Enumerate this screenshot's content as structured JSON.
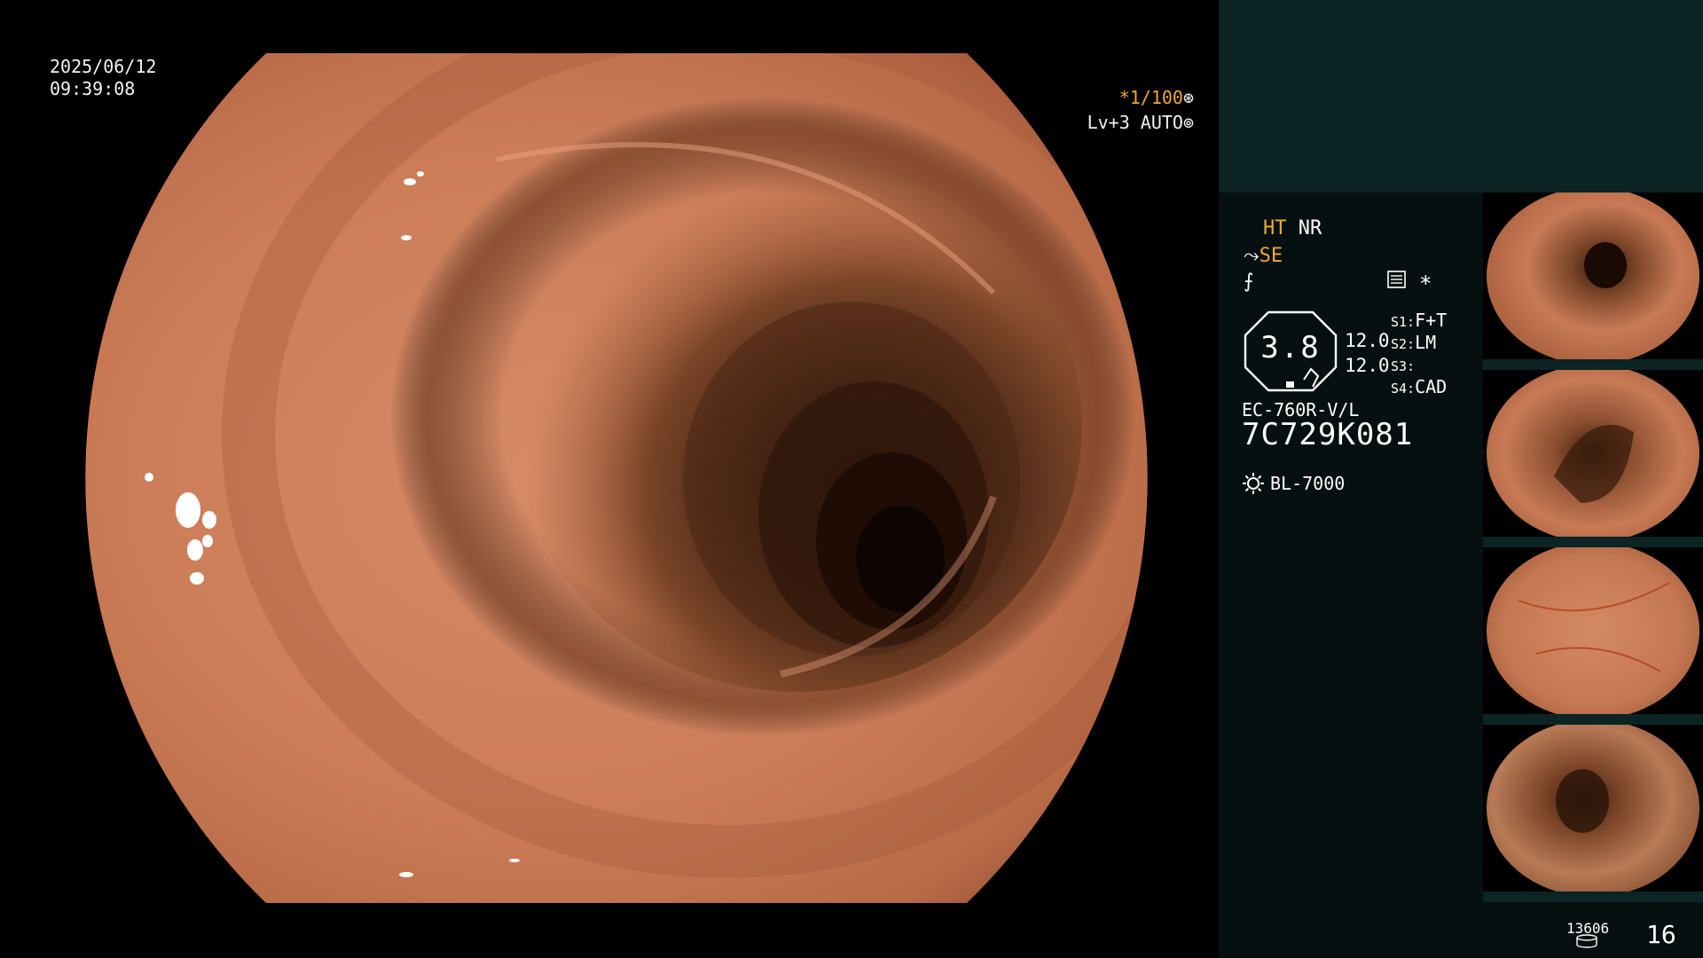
{
  "overlay": {
    "date": "2025/06/12",
    "time": "09:39:08",
    "shutter": "*1/100",
    "shutter_icon": "aperture-icon",
    "level": "Lv+3 AUTO",
    "level_icon": "iris-icon"
  },
  "panel": {
    "ht": "HT",
    "nr": "NR",
    "se": "SE",
    "se_icon": "structure-enhance-icon",
    "freeze_icon": "freeze-icon",
    "menu_icon": "menu-icon",
    "star": "*",
    "gauge_value": "3.8",
    "value_a": "12.0",
    "value_b": "12.0",
    "switches": [
      {
        "key": "S1:",
        "value": "F+T"
      },
      {
        "key": "S2:",
        "value": "LM"
      },
      {
        "key": "S3:",
        "value": ""
      },
      {
        "key": "S4:",
        "value": "CAD"
      }
    ],
    "scope_model": "EC-760R-V/L",
    "scope_serial": "7C729K081",
    "light_source": "BL-7000",
    "light_icon": "sun-icon",
    "image_counter": "13606",
    "disk_icon": "disk-icon",
    "page_number": "16"
  },
  "colors": {
    "accent_orange": "#f0a830",
    "panel_bg": "#061010",
    "panel_top_bg": "#0c2424"
  }
}
